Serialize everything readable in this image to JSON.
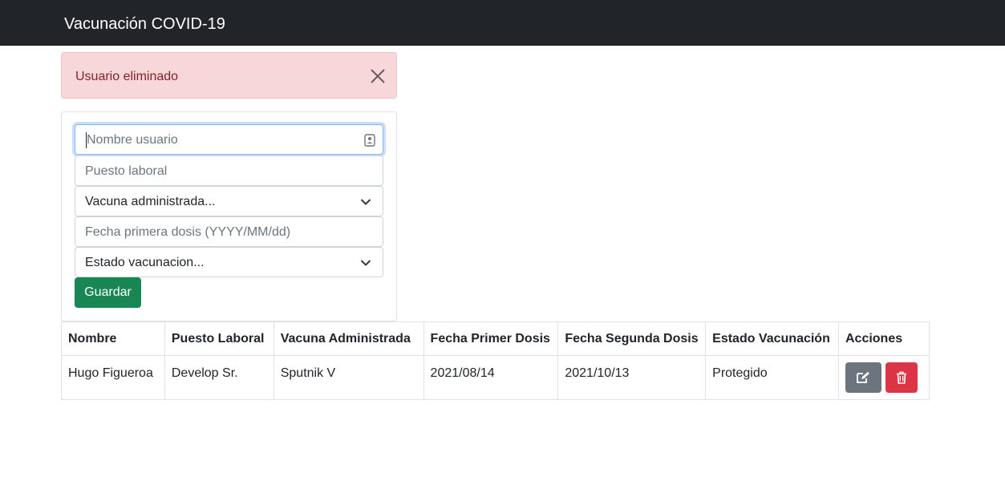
{
  "navbar": {
    "brand": "Vacunación COVID-19"
  },
  "alert": {
    "message": "Usuario eliminado",
    "close_icon": "close-icon"
  },
  "form": {
    "nombre": {
      "placeholder": "Nombre usuario",
      "value": ""
    },
    "puesto": {
      "placeholder": "Puesto laboral",
      "value": ""
    },
    "vacuna": {
      "selected": "Vacuna administrada..."
    },
    "fecha": {
      "placeholder": "Fecha primera dosis (YYYY/MM/dd)",
      "value": ""
    },
    "estado": {
      "selected": "Estado vacunacion..."
    },
    "save_label": "Guardar"
  },
  "table": {
    "headers": [
      "Nombre",
      "Puesto Laboral",
      "Vacuna Administrada",
      "Fecha Primer Dosis",
      "Fecha Segunda Dosis",
      "Estado Vacunación",
      "Acciones"
    ],
    "rows": [
      [
        "Hugo Figueroa",
        "Develop Sr.",
        "Sputnik V",
        "2021/08/14",
        "2021/10/13",
        "Protegido"
      ]
    ],
    "row_actions": [
      "edit-icon",
      "trash-icon"
    ]
  },
  "colors": {
    "navbar": "#212529",
    "success": "#198754",
    "danger": "#dc3545",
    "secondary": "#6c757d",
    "alert_bg": "#f8d7da",
    "alert_text": "#842029"
  }
}
